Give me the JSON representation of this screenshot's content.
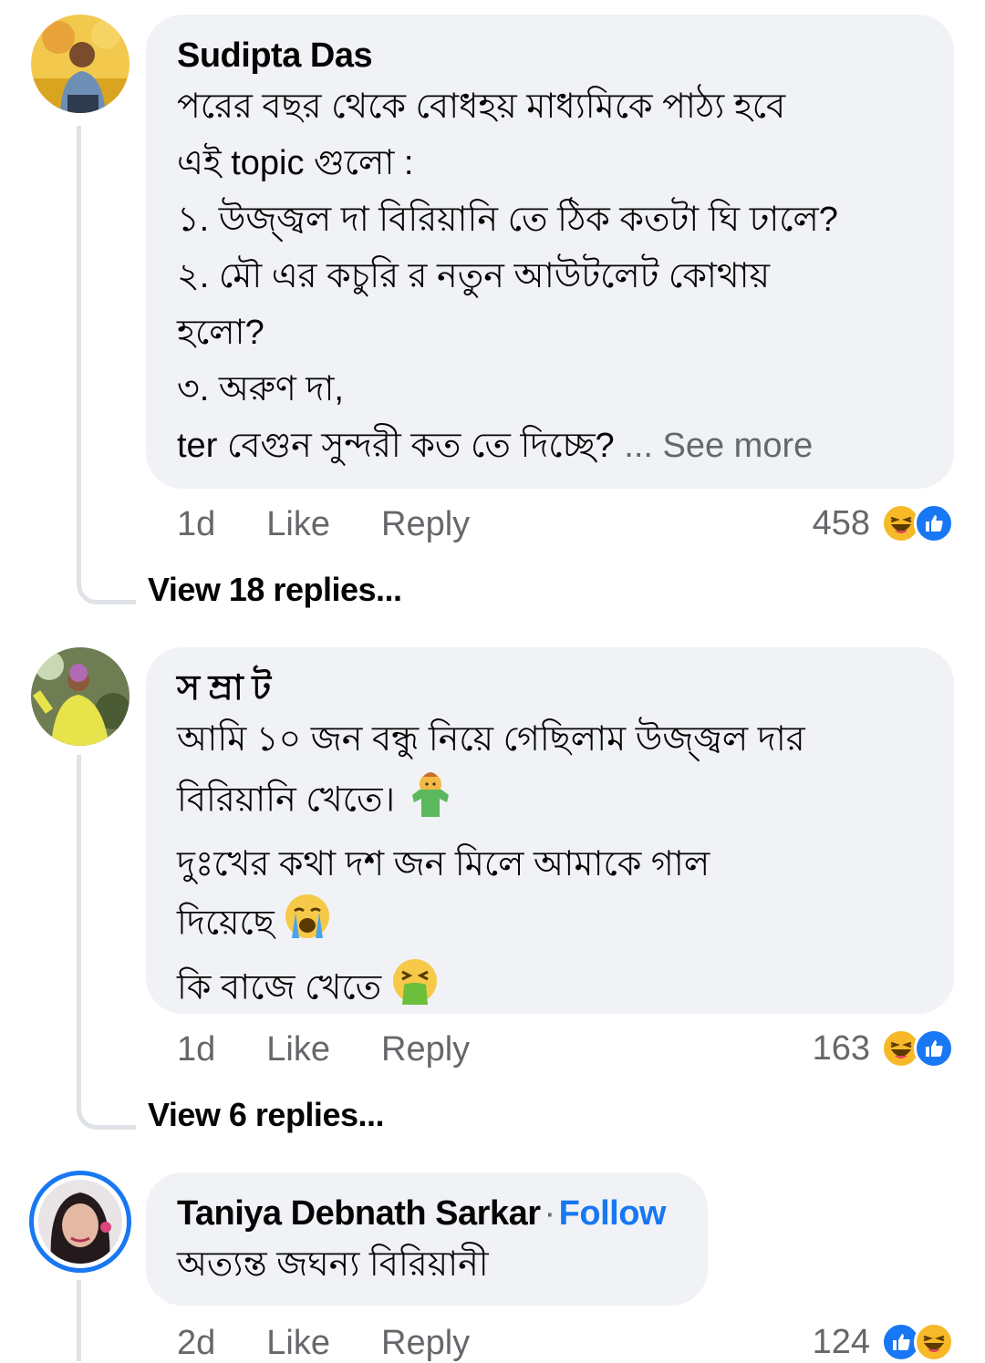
{
  "comments": [
    {
      "author": "Sudipta Das",
      "lines": [
        "পরের বছর থেকে বোধহয় মাধ্যমিকে পাঠ্য হবে",
        "এই topic গুলো :",
        "১. উজ্জ্বল দা বিরিয়ানি তে ঠিক কতটা ঘি ঢালে?",
        "২. মৌ এর কচুরি র নতুন আউটলেট কোথায়",
        "হলো?",
        "৩. অরুণ দা,",
        "ter বেগুন সুন্দরী কত তে দিচ্ছে?"
      ],
      "see_more": "... See more",
      "time": "1d",
      "like_label": "Like",
      "reply_label": "Reply",
      "reaction_count": "458",
      "reactions": [
        "haha-icon",
        "like-icon"
      ],
      "view_replies": "View 18 replies..."
    },
    {
      "author": "স ম্রা ট",
      "lines": [
        "আমি ১০ জন বন্ধু নিয়ে গেছিলাম উজ্জ্বল দার",
        "বিরিয়ানি খেতে।",
        "দুঃখের কথা দশ জন মিলে আমাকে গাল",
        "দিয়েছে",
        "কি বাজে খেতে"
      ],
      "inline_emojis": [
        "shrug-emoji",
        "crying-emoji",
        "vomit-emoji"
      ],
      "time": "1d",
      "like_label": "Like",
      "reply_label": "Reply",
      "reaction_count": "163",
      "reactions": [
        "haha-icon",
        "like-icon"
      ],
      "view_replies": "View 6 replies..."
    },
    {
      "author": "Taniya Debnath Sarkar",
      "follow_label": "Follow",
      "lines": [
        "অত্যন্ত জঘন্য বিরিয়ানী"
      ],
      "time": "2d",
      "like_label": "Like",
      "reply_label": "Reply",
      "reaction_count": "124",
      "reactions": [
        "like-icon",
        "haha-icon"
      ]
    }
  ],
  "colors": {
    "bubble": "#f0f2f5",
    "meta_text": "#65676b",
    "follow": "#1877f2",
    "haha": "#f7b928",
    "like": "#1877f2",
    "thread_line": "#dfe2e6"
  }
}
